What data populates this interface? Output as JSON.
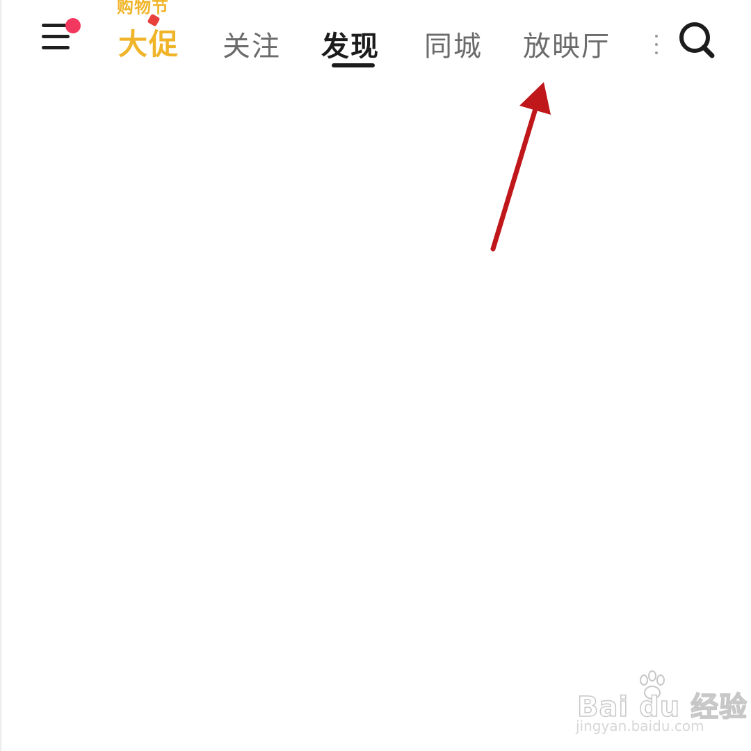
{
  "topbar": {
    "menu": {
      "badge_color": "#f2385f",
      "icon": "hamburger-menu-icon"
    },
    "promo": {
      "small_text": "购物节",
      "big_text": "大促",
      "color": "#f0b429"
    },
    "tabs": [
      {
        "label": "关注",
        "active": false
      },
      {
        "label": "发现",
        "active": true
      },
      {
        "label": "同城",
        "active": false
      },
      {
        "label": "放映厅",
        "active": false
      }
    ],
    "more_icon": "more-dots-icon",
    "search_icon": "search-icon"
  },
  "annotation": {
    "arrow_color": "#c0171b"
  },
  "watermark": {
    "brand": "Bai du 经验",
    "url": "jingyan.baidu.com"
  }
}
